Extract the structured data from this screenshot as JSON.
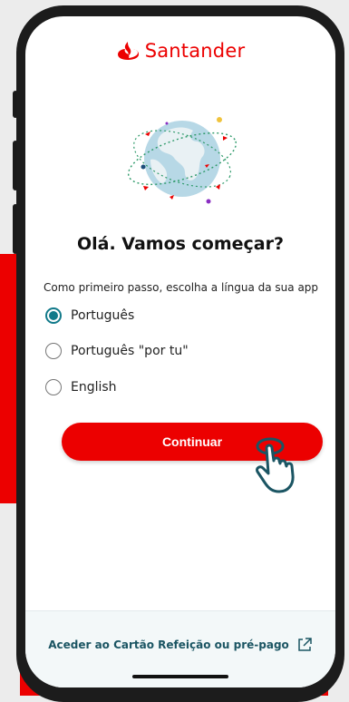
{
  "brand": {
    "name": "Santander",
    "color": "#ec0000"
  },
  "onboarding": {
    "title": "Olá. Vamos começar?",
    "subtitle": "Como primeiro passo, escolha a língua da sua app",
    "languages": [
      {
        "label": "Português",
        "selected": true
      },
      {
        "label": "Português \"por tu\"",
        "selected": false
      },
      {
        "label": "English",
        "selected": false
      }
    ],
    "continue_label": "Continuar"
  },
  "footer": {
    "link_label": "Aceder ao Cartão Refeição ou pré-pago",
    "link_icon": "external-link-icon"
  },
  "colors": {
    "accent": "#127a8a",
    "primary_button": "#ec0000",
    "link": "#1b5563"
  }
}
